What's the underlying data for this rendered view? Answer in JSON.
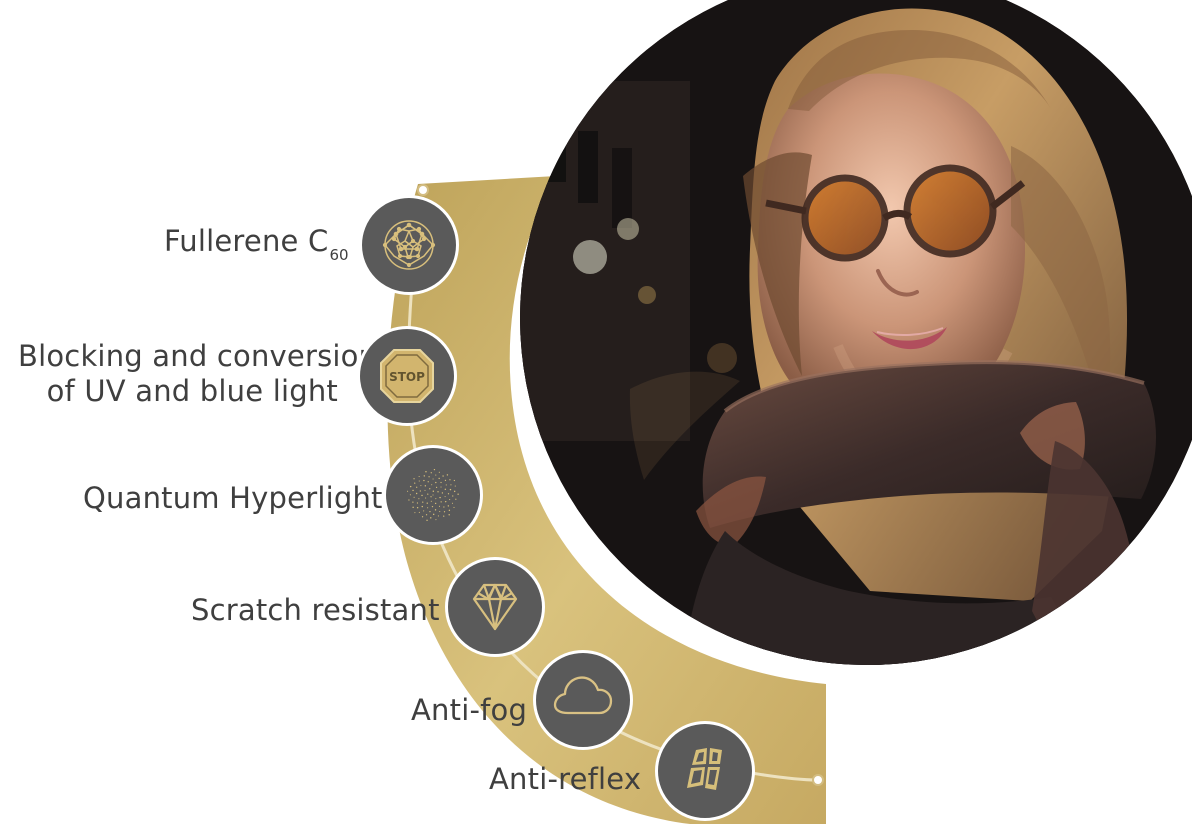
{
  "features": [
    {
      "label_main": "Fullerene C",
      "label_sub": "60",
      "icon": "fullerene-icon"
    },
    {
      "label_line1": "Blocking and conversion",
      "label_line2": "of UV and blue light",
      "icon": "stop-sign-icon",
      "icon_text": "STOP"
    },
    {
      "label": "Quantum Hyperlight",
      "icon": "dot-spiral-icon"
    },
    {
      "label": "Scratch resistant",
      "icon": "diamond-icon"
    },
    {
      "label": "Anti-fog",
      "icon": "cloud-icon"
    },
    {
      "label": "Anti-reflex",
      "icon": "reflective-panels-icon"
    }
  ],
  "colors": {
    "gold": "#c9ad6a",
    "gold_light": "#e6d7a4",
    "icon_bg": "#5a5a5a",
    "text": "#3f3f3f"
  },
  "illustration": {
    "subject": "woman-with-amber-glasses-using-tablet"
  }
}
